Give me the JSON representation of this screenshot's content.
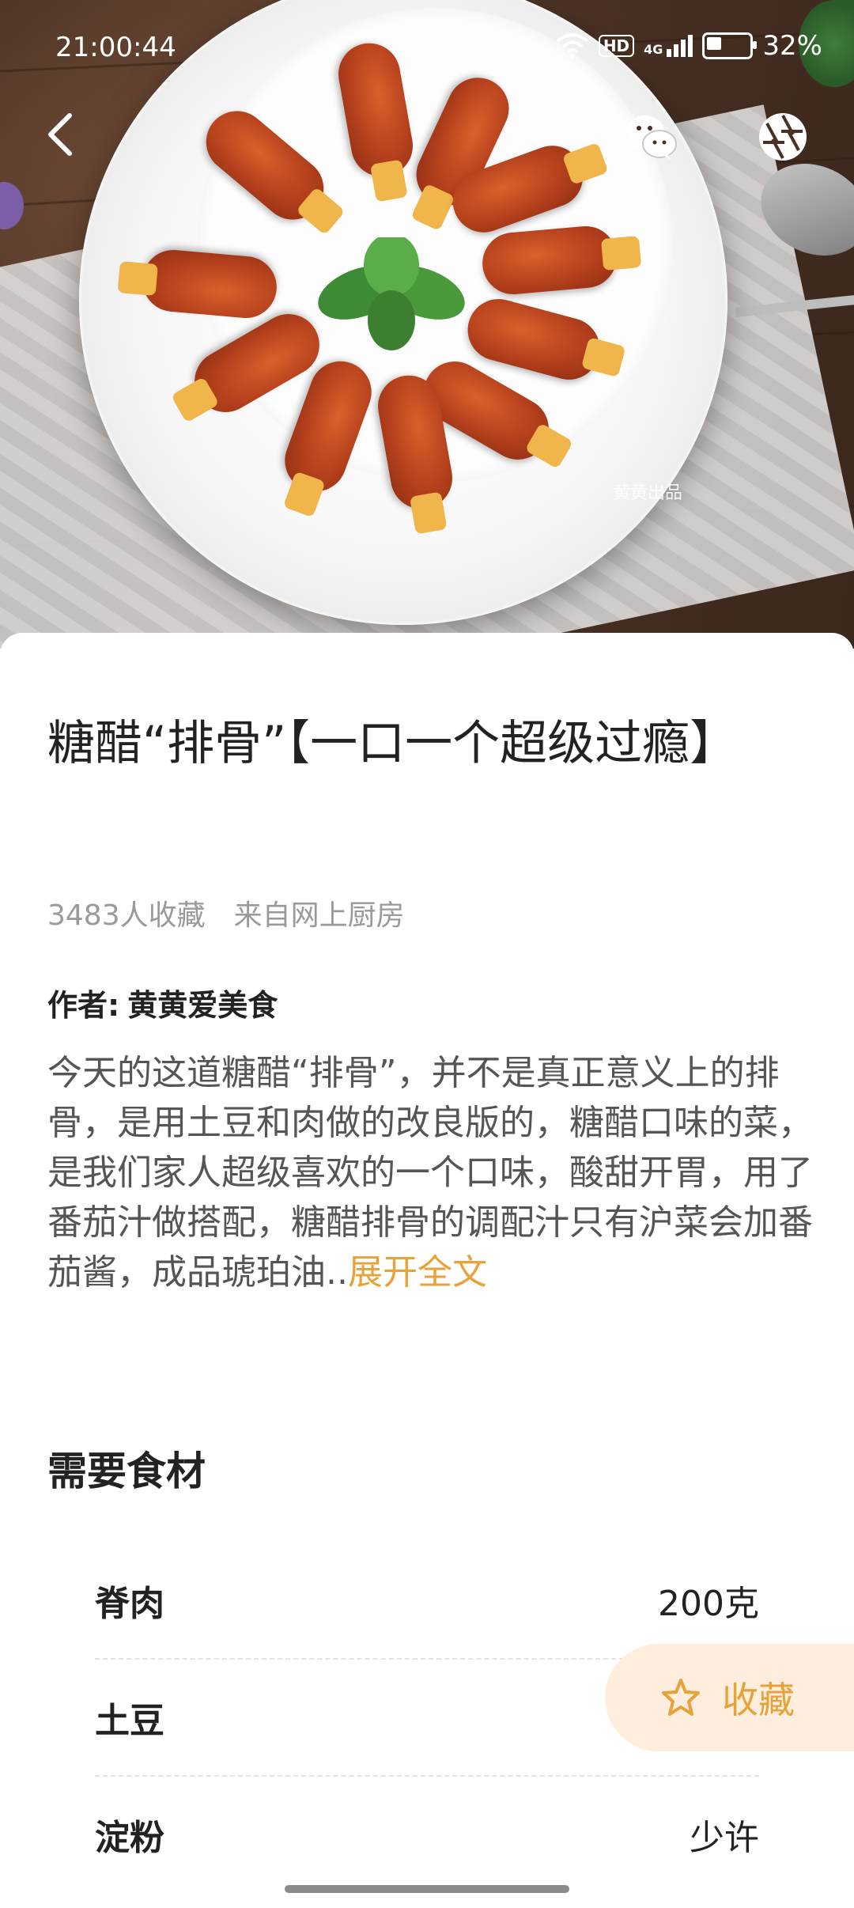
{
  "status_bar": {
    "time": "21:00:44",
    "network": "4G",
    "hd": "HD",
    "battery": "32%"
  },
  "hero": {
    "watermark": "黄黄出品",
    "image_alt": "糖醋排骨 dish photo"
  },
  "recipe": {
    "title": "糖醋“排骨”【一口一个超级过瘾】",
    "favorites": "3483人收藏",
    "source": "来自网上厨房",
    "author_label": "作者:",
    "author_name": "黄黄爱美食",
    "description": "今天的这道糖醋“排骨”，并不是真正意义上的排骨，是用土豆和肉做的改良版的，糖醋口味的菜，是我们家人超级喜欢的一个口味，酸甜开胃，用了番茄汁做搭配，糖醋排骨的调配汁只有沪菜会加番茄酱，成品琥珀油..",
    "expand_label": "展开全文"
  },
  "ingredients": {
    "title": "需要食材",
    "items": [
      {
        "name": "脊肉",
        "amount": "200克"
      },
      {
        "name": "土豆",
        "amount": ""
      },
      {
        "name": "淀粉",
        "amount": "少许"
      }
    ]
  },
  "favorite_button": {
    "label": "收藏"
  },
  "colors": {
    "accent": "#e8a23a",
    "fav_bg": "#fdeedd"
  }
}
